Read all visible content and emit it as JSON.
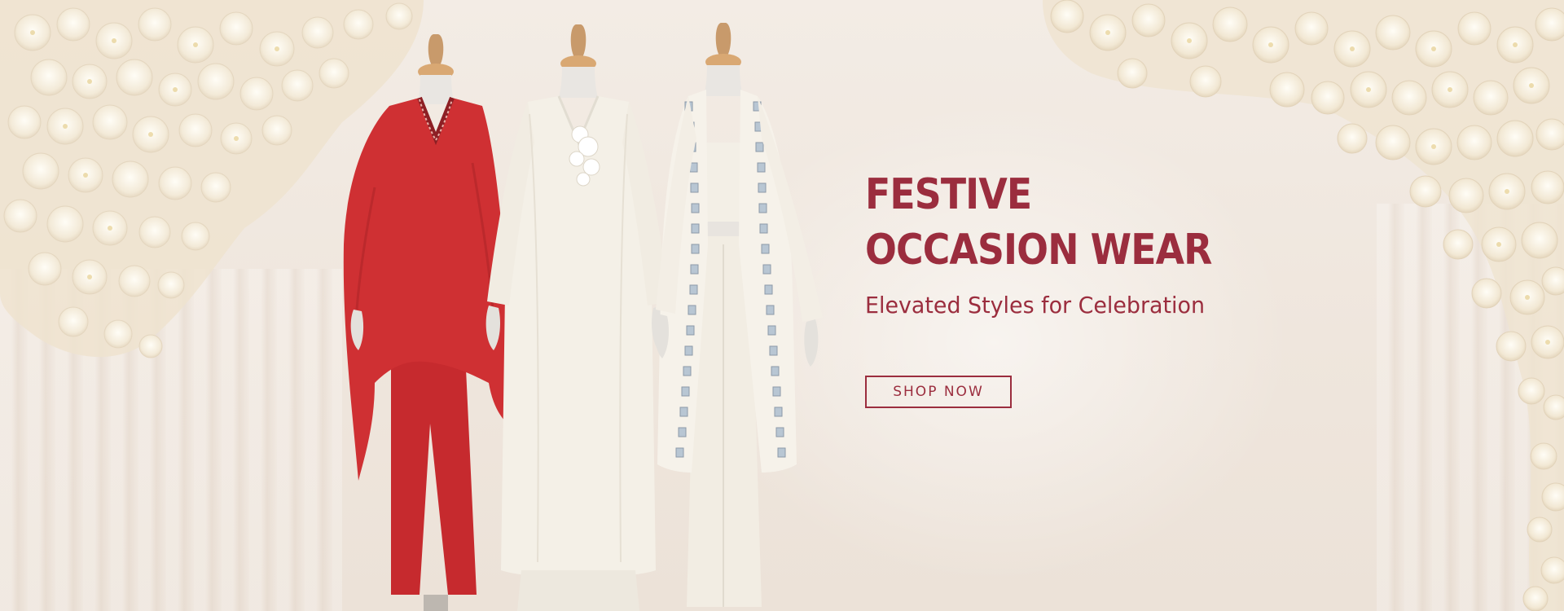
{
  "banner": {
    "headline": {
      "line1": "FESTIVE",
      "line2": "OCCASION WEAR"
    },
    "subheading": "Elevated Styles for Celebration",
    "cta_label": "SHOP NOW",
    "colors": {
      "accent": "#9b2d3e",
      "background": "#f1e9e1",
      "garment_red": "#c62a2e",
      "garment_ivory": "#f3efe6"
    },
    "visual": {
      "mannequins": [
        {
          "outfit": "red kaftan top with embellished neckline and red trousers"
        },
        {
          "outfit": "ivory embroidered kurta with wide trousers"
        },
        {
          "outfit": "ivory crop top, palazzo and mirror-work long jacket"
        }
      ],
      "decor": "white flower clusters framing top corners"
    }
  }
}
